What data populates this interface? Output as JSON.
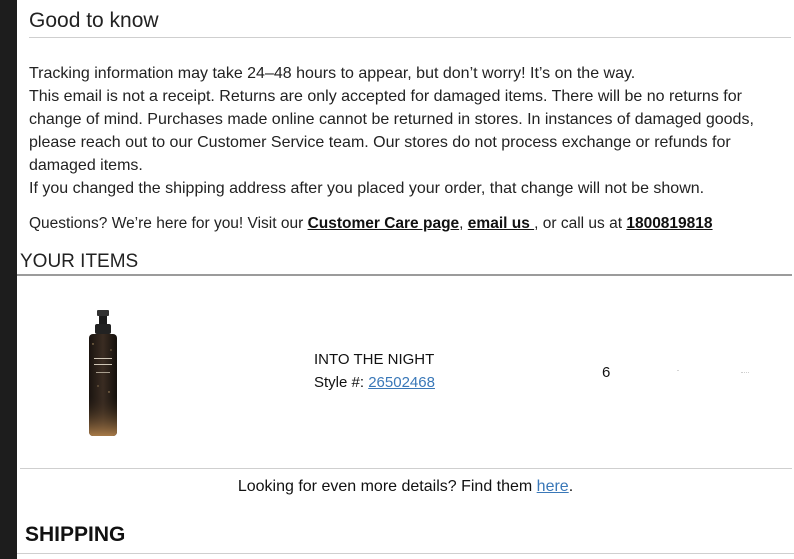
{
  "good_to_know": {
    "title": "Good to know",
    "lines": [
      "Tracking information may take 24–48 hours to appear, but don’t worry! It’s on the way.",
      "This email is not a receipt. Returns are only accepted for damaged items. There will be no returns for change of mind. Purchases made online cannot be returned in stores. In instances of damaged goods, please reach out to our Customer Service team. Our stores do not process exchange or refunds for damaged items.",
      "If you changed the shipping address after you placed your order, that change will not be shown."
    ],
    "questions": {
      "prefix": "Questions? We’re here for you! Visit our ",
      "customer_care_link": "Customer Care page",
      "comma": ", ",
      "email_link": "email us ",
      "middle": ", or call us at ",
      "phone": "1800819818"
    }
  },
  "items": {
    "title": "YOUR ITEMS",
    "product": {
      "name": "INTO THE NIGHT",
      "style_label": "Style #: ",
      "style_number": "26502468",
      "quantity": "6",
      "bottle_label": "INTO THE NIGHT"
    }
  },
  "details": {
    "prefix": "Looking for even more details? Find them ",
    "link": "here",
    "suffix": "."
  },
  "shipping": {
    "title": "SHIPPING"
  }
}
